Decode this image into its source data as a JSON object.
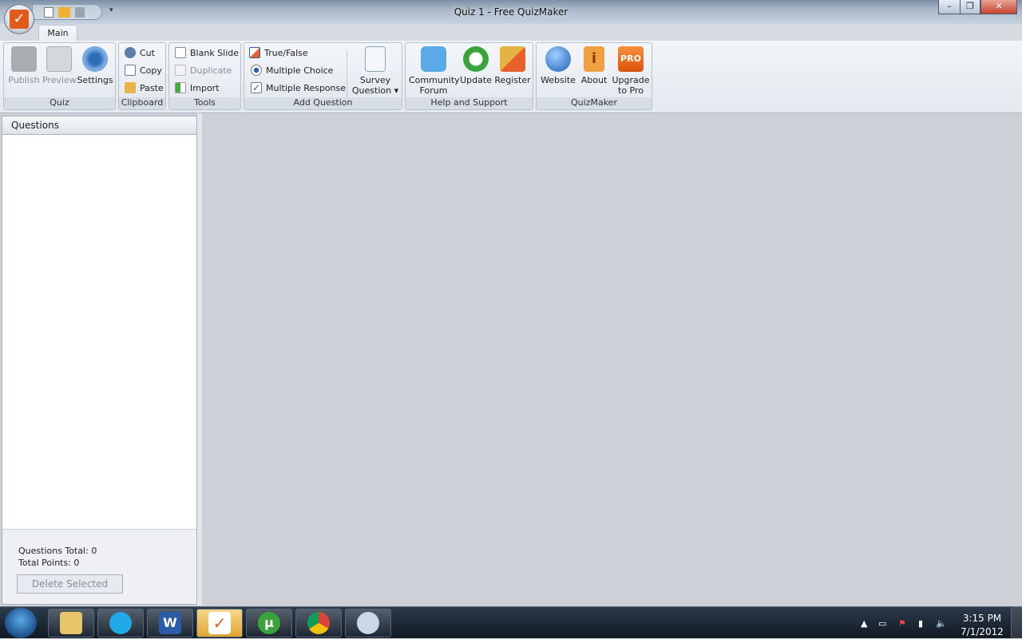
{
  "window": {
    "title": "Quiz 1 - Free QuizMaker",
    "minimize": "–",
    "restore": "❐",
    "close": "✕"
  },
  "tabs": [
    {
      "label": "Main"
    }
  ],
  "ribbon": {
    "quiz": {
      "label": "Quiz",
      "publish": "Publish",
      "preview": "Preview",
      "settings": "Settings"
    },
    "clipboard": {
      "label": "Clipboard",
      "cut": "Cut",
      "copy": "Copy",
      "paste": "Paste"
    },
    "tools": {
      "label": "Tools",
      "blank_slide": "Blank Slide",
      "duplicate": "Duplicate",
      "import": "Import"
    },
    "add_question": {
      "label": "Add Question",
      "true_false": "True/False",
      "multiple_choice": "Multiple Choice",
      "multiple_response": "Multiple Response",
      "survey_1": "Survey",
      "survey_2": "Question"
    },
    "help": {
      "label": "Help and Support",
      "community_1": "Community",
      "community_2": "Forum",
      "update": "Update",
      "register": "Register"
    },
    "quizmaker": {
      "label": "QuizMaker",
      "website": "Website",
      "about": "About",
      "upgrade_1": "Upgrade",
      "upgrade_2": "to Pro",
      "pro_badge": "PRO"
    }
  },
  "questions_panel": {
    "title": "Questions",
    "total": "Questions Total: 0",
    "points": "Total Points: 0",
    "delete": "Delete Selected"
  },
  "taskbar": {
    "time": "3:15 PM",
    "date": "7/1/2012",
    "apps": [
      "Windows Explorer",
      "Skype",
      "Word",
      "QuizMaker",
      "uTorrent",
      "Chrome",
      "Paint"
    ],
    "word_glyph": "W",
    "utorrent_glyph": "µ"
  }
}
